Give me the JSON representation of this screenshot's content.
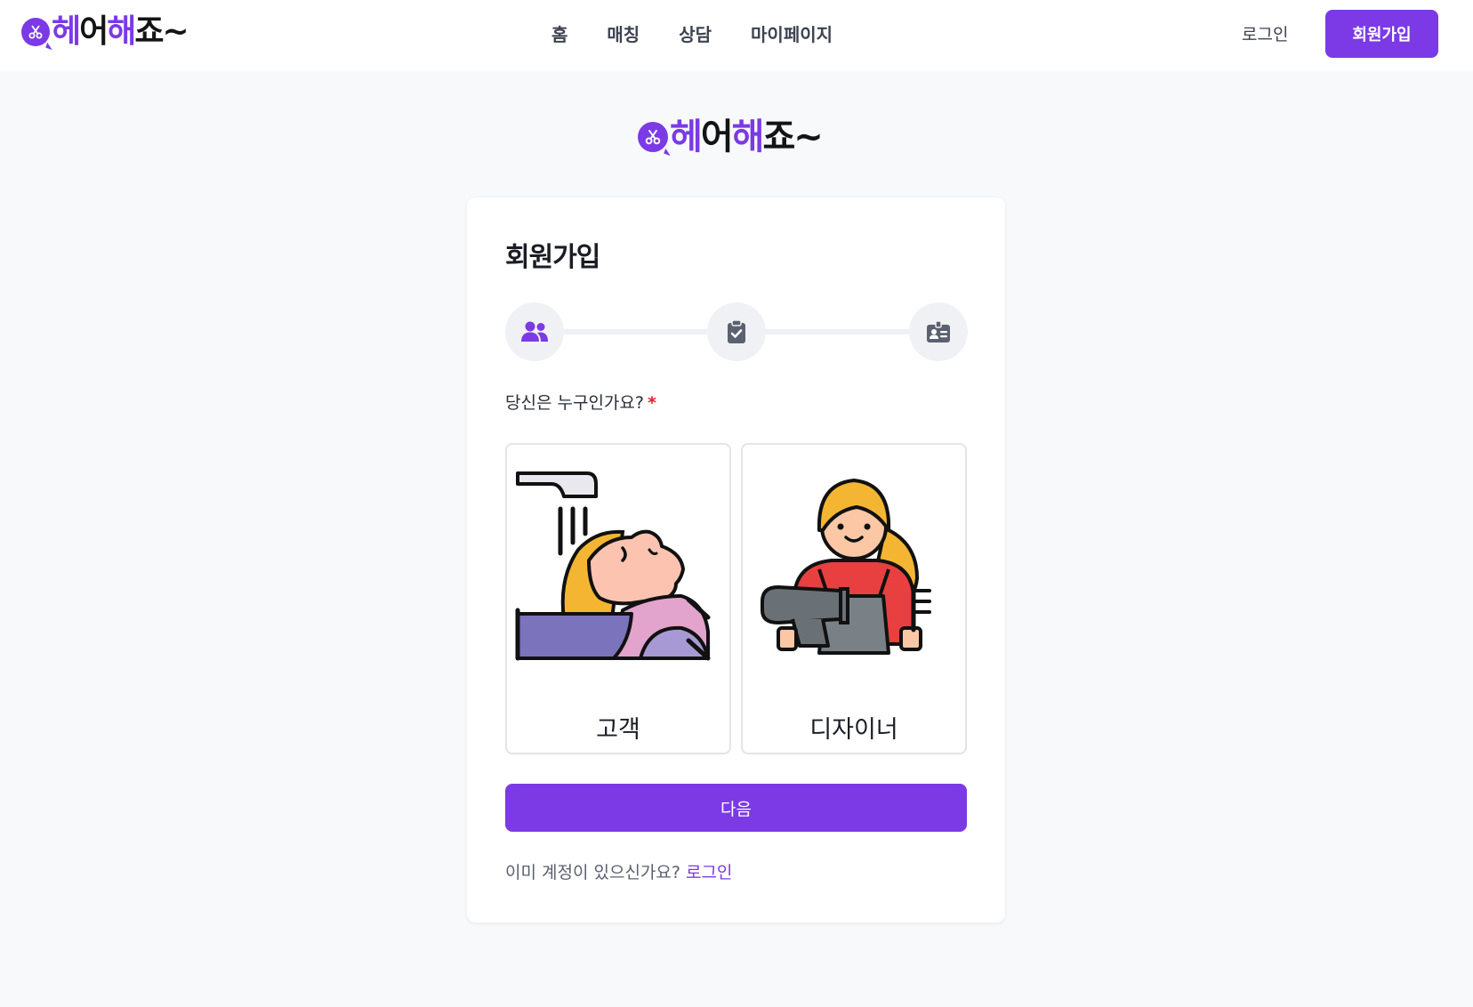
{
  "brand": {
    "logo_text_parts": [
      "헤",
      "어",
      "해",
      "죠~"
    ],
    "accent_color": "#7b3ae6"
  },
  "header": {
    "nav": [
      "홈",
      "매칭",
      "상담",
      "마이페이지"
    ],
    "login_label": "로그인",
    "signup_label": "회원가입"
  },
  "signup": {
    "title": "회원가입",
    "steps": [
      {
        "icon": "users-icon",
        "active": true
      },
      {
        "icon": "clipboard-check-icon",
        "active": false
      },
      {
        "icon": "id-card-icon",
        "active": false
      }
    ],
    "question": "당신은 누구인가요?",
    "required_mark": "*",
    "roles": [
      {
        "label": "고객",
        "illustration": "hair-washing-customer-illustration"
      },
      {
        "label": "디자이너",
        "illustration": "hair-designer-illustration"
      }
    ],
    "next_label": "다음",
    "footer_text": "이미 계정이 있으신가요?",
    "footer_link": "로그인"
  }
}
